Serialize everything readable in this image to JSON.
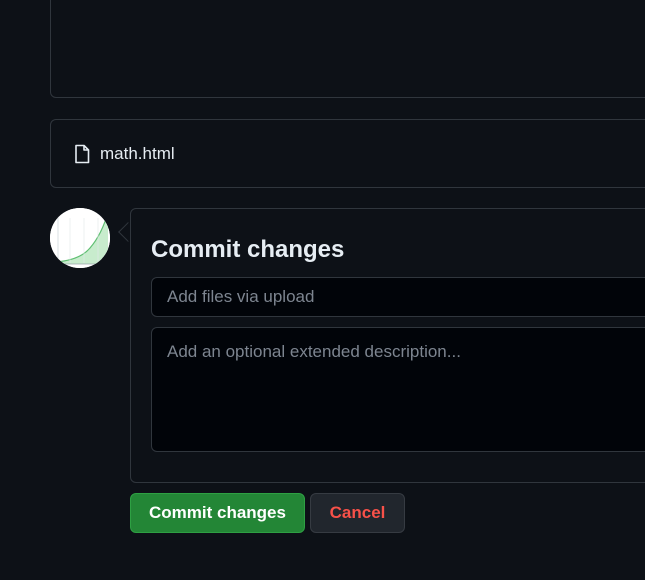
{
  "file_list": {
    "files": [
      {
        "name": "math.html",
        "icon": "file-icon"
      }
    ]
  },
  "avatar": {
    "icon": "avatar-image"
  },
  "commit": {
    "title": "Commit changes",
    "summary_placeholder": "Add files via upload",
    "description_placeholder": "Add an optional extended description...",
    "commit_button_label": "Commit changes",
    "cancel_button_label": "Cancel"
  },
  "colors": {
    "background": "#0d1117",
    "border": "#30363d",
    "commit_button": "#238636",
    "cancel_text": "#f85149"
  }
}
